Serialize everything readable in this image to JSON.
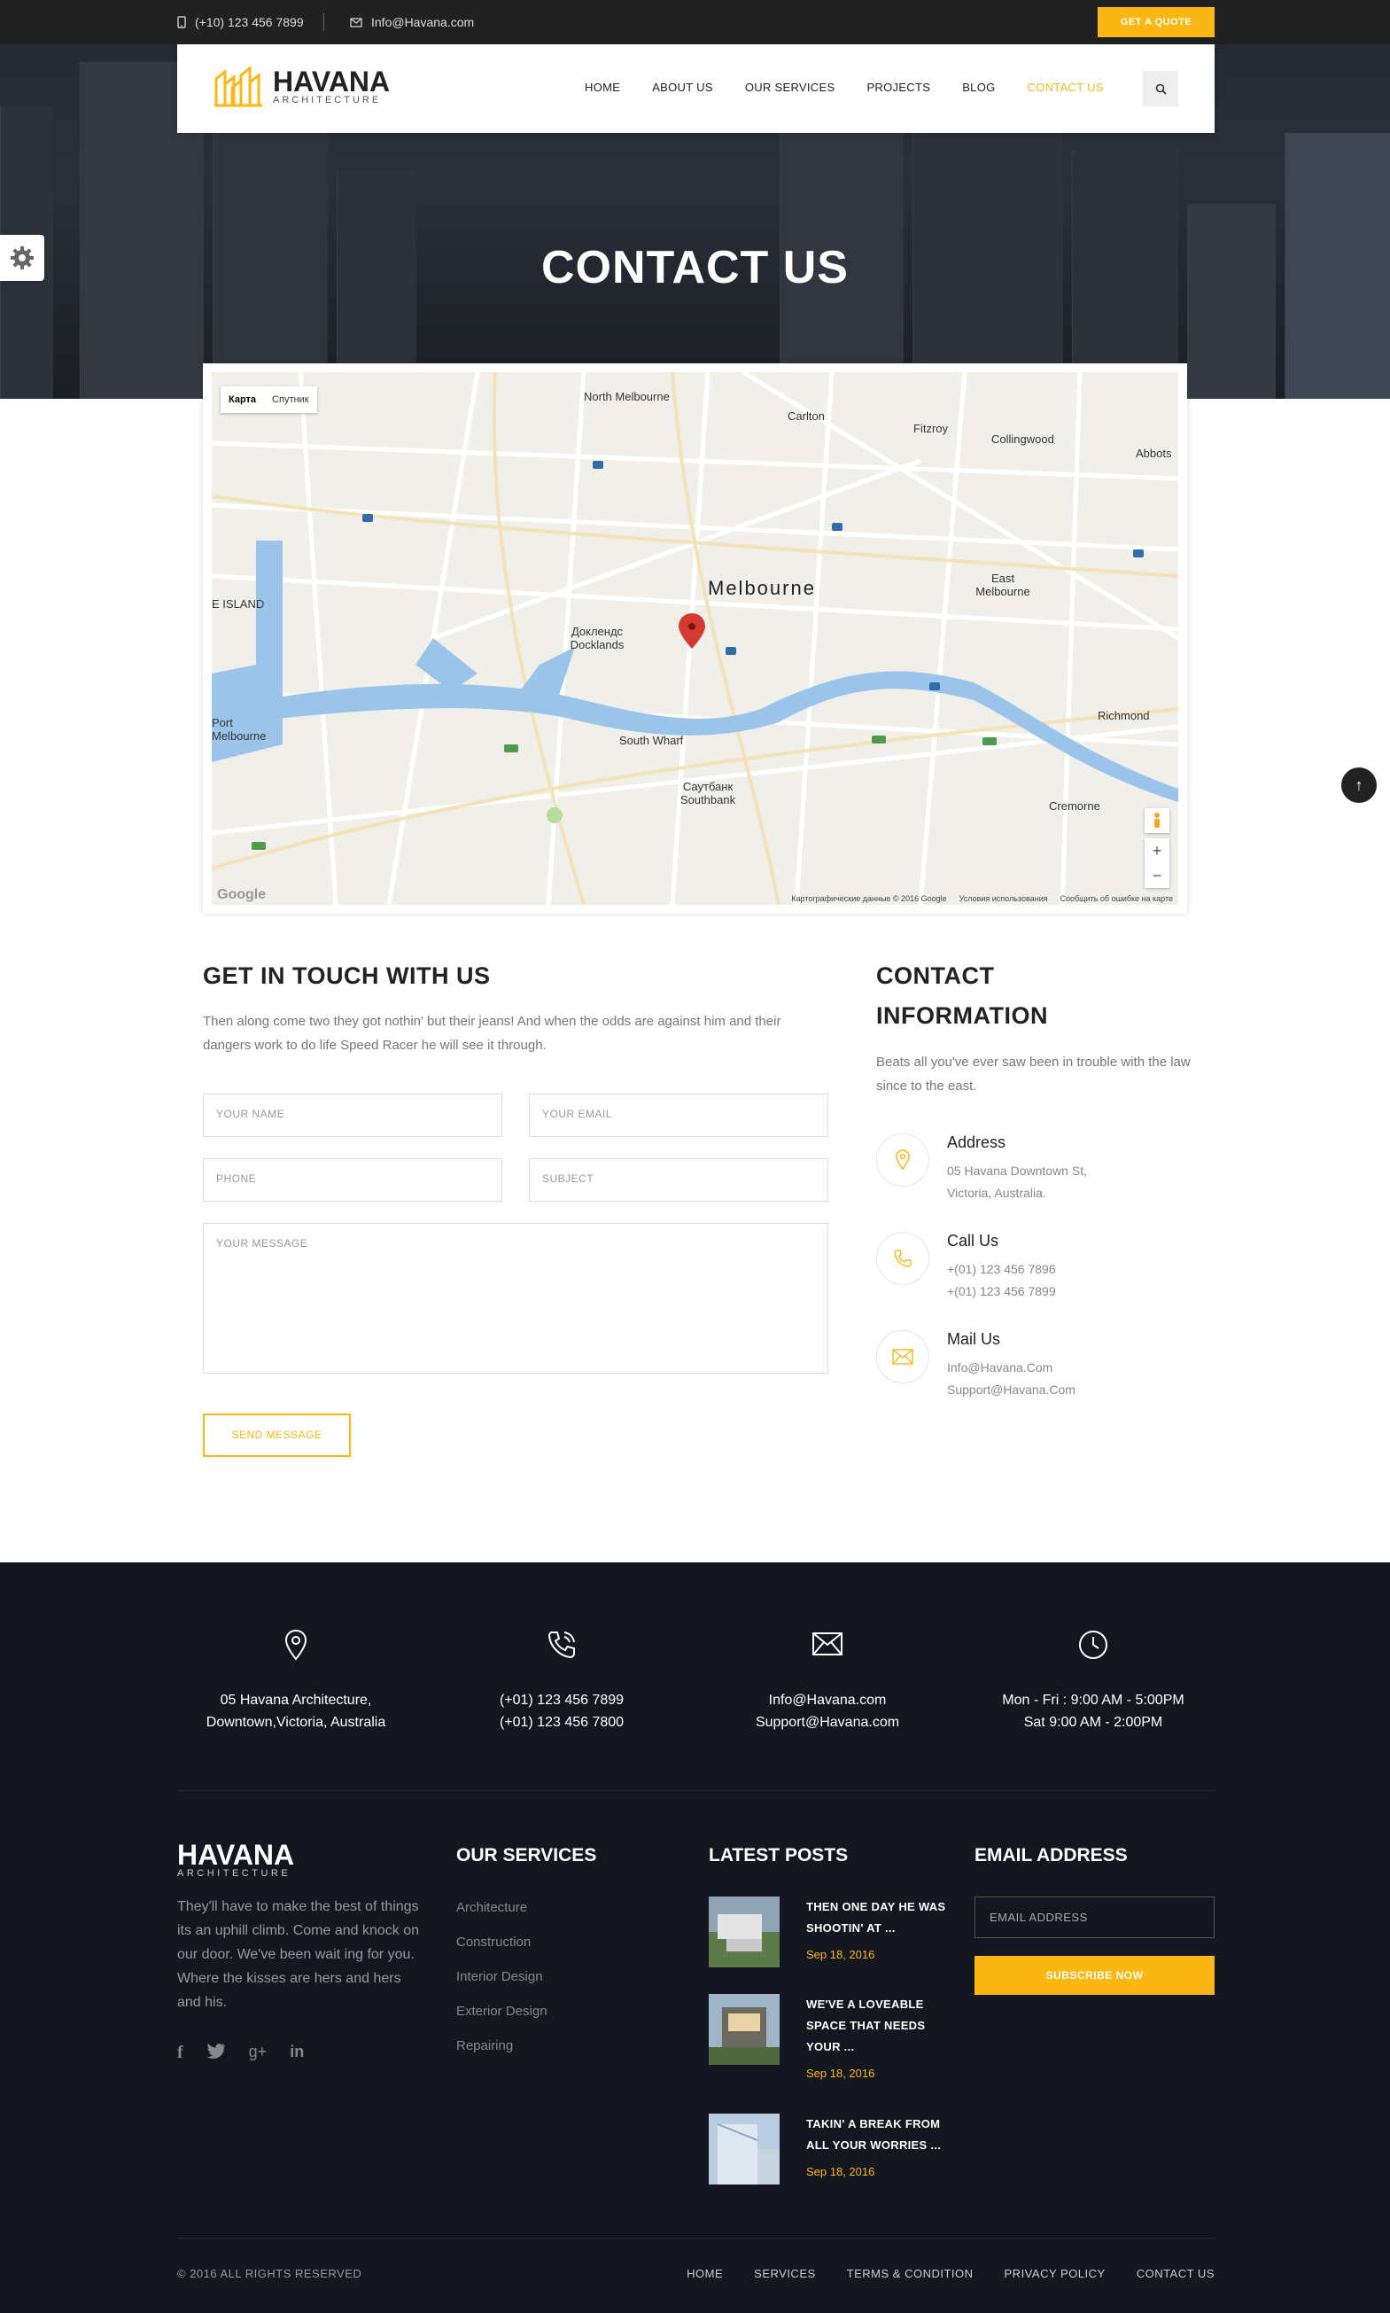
{
  "topbar": {
    "phone": "(+10) 123 456 7899",
    "email": "Info@Havana.com",
    "quote_button": "GET A QUOTE"
  },
  "brand": {
    "name": "HAVANA",
    "tagline": "ARCHITECTURE"
  },
  "nav": {
    "items": [
      "HOME",
      "ABOUT US",
      "OUR SERVICES",
      "PROJECTS",
      "BLOG",
      "CONTACT US"
    ],
    "active": "CONTACT US"
  },
  "hero": {
    "title": "CONTACT US"
  },
  "map": {
    "tabs": [
      "Карта",
      "Спутник"
    ],
    "city": "Melbourne",
    "places": [
      "North Melbourne",
      "Carlton",
      "Fitzroy",
      "Collingwood",
      "Abbots",
      "East Melbourne",
      "Доклендс Docklands",
      "Richmond",
      "South Wharf",
      "Саутбанк Southbank",
      "Cremorne",
      "Port Melbourne",
      "E ISLAND"
    ],
    "footer": [
      "Картографические данные © 2016 Google",
      "Условия использования",
      "Сообщить об ошибке на карте"
    ],
    "google": "Google",
    "zoom_in": "+",
    "zoom_out": "−"
  },
  "form": {
    "heading": "GET IN TOUCH WITH US",
    "intro": "Then along come two they got nothin' but their jeans! And when the odds are against him and their dangers work to do life Speed Racer he will see it through.",
    "name_placeholder": "YOUR NAME",
    "email_placeholder": "YOUR EMAIL",
    "phone_placeholder": "PHONE",
    "subject_placeholder": "SUBJECT",
    "message_placeholder": "YOUR MESSAGE",
    "send_label": "SEND MESSAGE"
  },
  "contact": {
    "heading_line1": "CONTACT",
    "heading_line2": "INFORMATION",
    "intro": "Beats all you've ever saw been in trouble with the law since to the east.",
    "address": {
      "title": "Address",
      "line1": "05 Havana Downtown St,",
      "line2": "Victoria, Australia."
    },
    "call": {
      "title": "Call Us",
      "line1": "+(01) 123 456 7896",
      "line2": "+(01) 123 456 7899"
    },
    "mail": {
      "title": "Mail Us",
      "line1": "Info@Havana.Com",
      "line2": "Support@Havana.Com"
    }
  },
  "footer": {
    "info": [
      {
        "icon": "location-pin-icon",
        "line1": "05 Havana Architecture,",
        "line2": "Downtown,Victoria, Australia"
      },
      {
        "icon": "phone-icon",
        "line1": "(+01) 123 456 7899",
        "line2": "(+01) 123 456 7800"
      },
      {
        "icon": "envelope-icon",
        "line1": "Info@Havana.com",
        "line2": "Support@Havana.com"
      },
      {
        "icon": "clock-icon",
        "line1": "Mon - Fri : 9:00 AM - 5:00PM",
        "line2": "Sat 9:00 AM - 2:00PM"
      }
    ],
    "about": "They'll have to make the best of things its an uphill climb. Come and knock on our door. We've been wait ing for you. Where the kisses are hers and hers and his.",
    "services_heading": "OUR SERVICES",
    "services": [
      "Architecture",
      "Construction",
      "Interior Design",
      "Exterior Design",
      "Repairing"
    ],
    "posts_heading": "LATEST POSTS",
    "posts": [
      {
        "title": "THEN ONE DAY HE WAS SHOOTIN' AT ...",
        "date": "Sep 18, 2016"
      },
      {
        "title": "WE'VE A LOVEABLE SPACE THAT NEEDS YOUR ...",
        "date": "Sep 18, 2016"
      },
      {
        "title": "TAKIN' A BREAK FROM ALL YOUR WORRIES ...",
        "date": "Sep 18, 2016"
      }
    ],
    "email_heading": "EMAIL ADDRESS",
    "email_placeholder": "EMAIL ADDRESS",
    "subscribe_label": "SUBSCRIBE NOW",
    "copyright": "© 2016 ALL RIGHTS RESERVED",
    "links": [
      "HOME",
      "SERVICES",
      "TERMS & CONDITION",
      "PRIVACY POLICY",
      "CONTACT US"
    ]
  },
  "colors": {
    "accent": "#fbb713",
    "dark": "#212121",
    "footer_bg": "#151720"
  }
}
